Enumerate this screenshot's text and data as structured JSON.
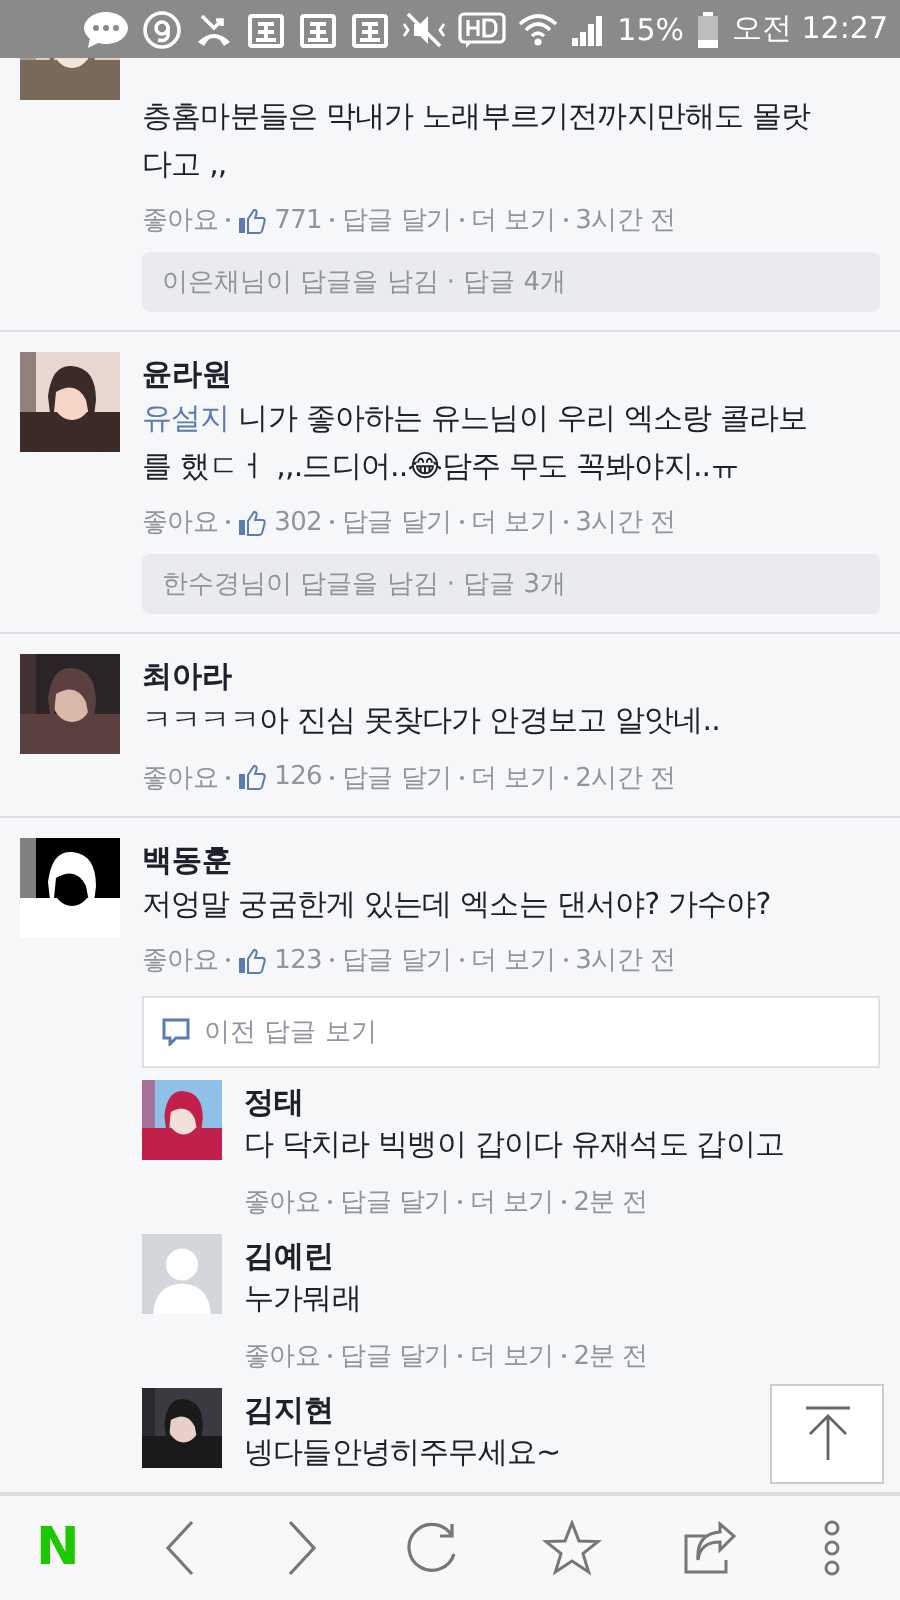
{
  "status_bar": {
    "battery": "15%",
    "time": "오전 12:27"
  },
  "comments": [
    {
      "avatar": {
        "kind": "picture"
      },
      "text": "층홈마분들은 막내가 노래부르기전까지만해도 몰랏다고 ,,",
      "meta": {
        "like_label": "좋아요",
        "likes": "771",
        "reply_label": "답글 달기",
        "more_label": "더 보기",
        "time": "3시간 전"
      },
      "reply_summary": "이은채님이 답글을 남김 · 답글 4개"
    },
    {
      "avatar": {
        "kind": "picture"
      },
      "name": "윤라원",
      "mention": "유설지",
      "text": "니가 좋아하는 유느님이 우리 엑소랑 콜라보를 했ㄷㅓ ,,.드디어..😂담주 무도 꼭봐야지..ㅠ",
      "meta": {
        "like_label": "좋아요",
        "likes": "302",
        "reply_label": "답글 달기",
        "more_label": "더 보기",
        "time": "3시간 전"
      },
      "reply_summary": "한수경님이 답글을 남김 · 답글 3개"
    },
    {
      "avatar": {
        "kind": "picture"
      },
      "name": "최아라",
      "text": "ㅋㅋㅋㅋ아 진심 못찾다가 안경보고 알앗네..",
      "meta": {
        "like_label": "좋아요",
        "likes": "126",
        "reply_label": "답글 달기",
        "more_label": "더 보기",
        "time": "2시간 전"
      }
    },
    {
      "avatar": {
        "kind": "picture"
      },
      "name": "백동훈",
      "text": "저엉말 궁굼한게 있는데 엑소는 댄서야? 가수야?",
      "meta": {
        "like_label": "좋아요",
        "likes": "123",
        "reply_label": "답글 달기",
        "more_label": "더 보기",
        "time": "3시간 전"
      },
      "previous_replies": "이전 답글 보기",
      "replies": [
        {
          "avatar": {
            "kind": "picture"
          },
          "name": "정태",
          "text": "다 닥치라 빅뱅이 갑이다 유재석도 갑이고",
          "meta": {
            "like_label": "좋아요",
            "reply_label": "답글 달기",
            "more_label": "더 보기",
            "time": "2분 전"
          }
        },
        {
          "avatar": {
            "kind": "placeholder"
          },
          "name": "김예린",
          "text": "누가뭐래",
          "meta": {
            "like_label": "좋아요",
            "reply_label": "답글 달기",
            "more_label": "더 보기",
            "time": "2분 전"
          }
        },
        {
          "avatar": {
            "kind": "picture"
          },
          "name": "김지현",
          "text": "넹다들안녕히주무세요~"
        }
      ]
    }
  ],
  "bottom_bar": {
    "logo": "N"
  }
}
